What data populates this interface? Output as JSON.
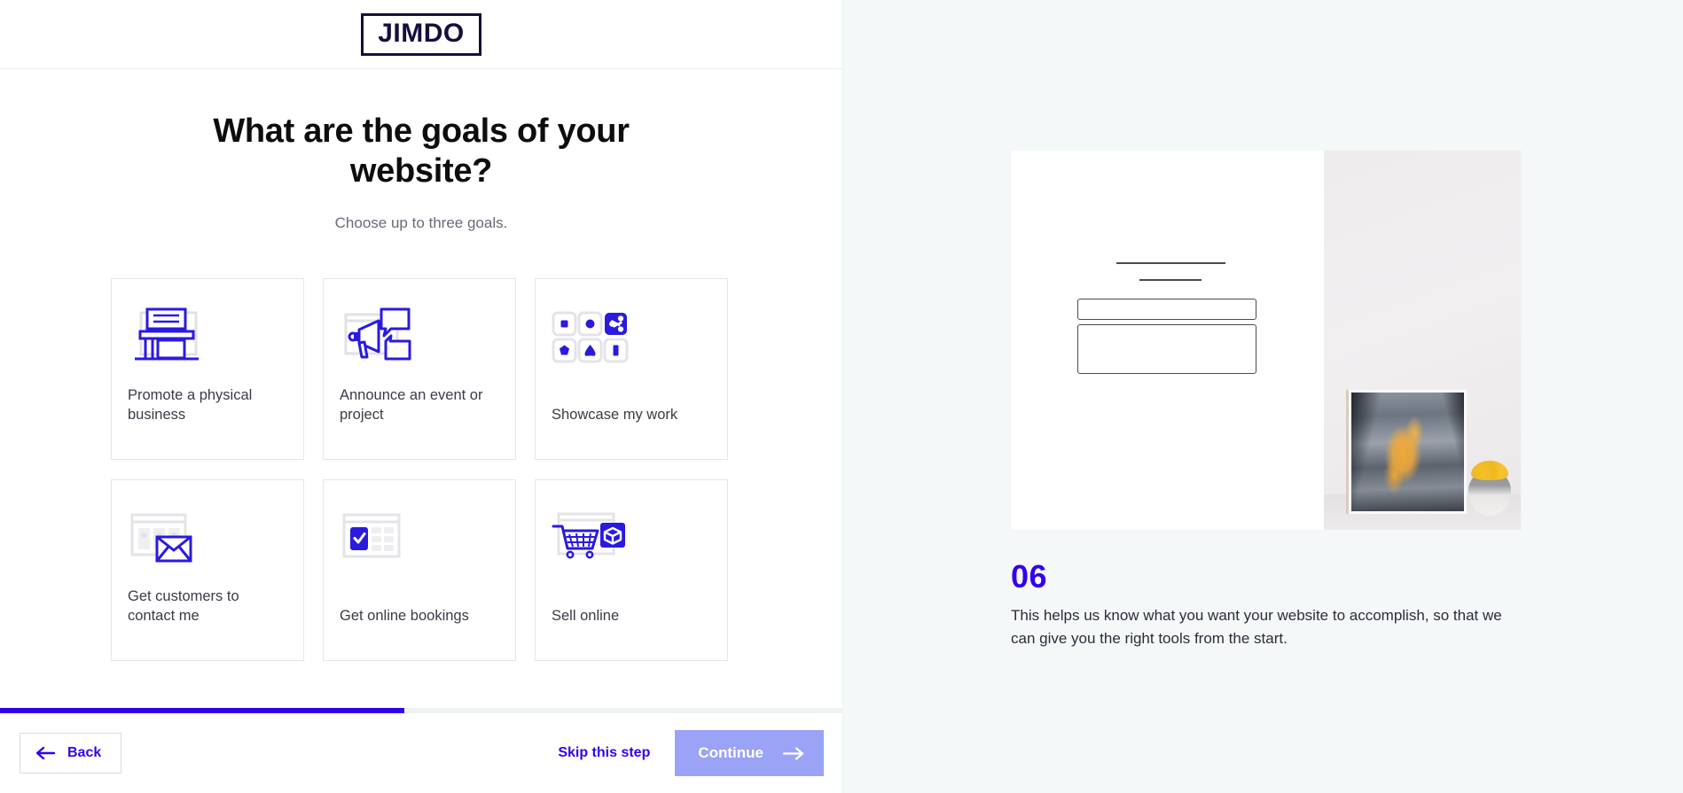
{
  "brand": {
    "logo_text": "JIMDO",
    "accent_blue": "#3300ee",
    "logo_navy": "#140f3c",
    "continue_disabled_bg": "#9aa3f5"
  },
  "header": {
    "title": "What are the goals of your website?",
    "subtitle": "Choose up to three goals."
  },
  "goals": [
    {
      "label": "Promote a physical business",
      "icon": "storefront-icon"
    },
    {
      "label": "Announce an event or project",
      "icon": "megaphone-icon"
    },
    {
      "label": "Showcase my work",
      "icon": "gallery-share-icon"
    },
    {
      "label": "Get customers to contact me",
      "icon": "envelope-icon"
    },
    {
      "label": "Get online bookings",
      "icon": "calendar-check-icon"
    },
    {
      "label": "Sell online",
      "icon": "shopping-cart-icon"
    }
  ],
  "footer": {
    "progress_percent": 48,
    "back_label": "Back",
    "skip_label": "Skip this step",
    "continue_label": "Continue"
  },
  "preview": {
    "step_number": "06",
    "description": "This helps us know what you want your website to accomplish, so that we can give you the right tools from the start."
  }
}
